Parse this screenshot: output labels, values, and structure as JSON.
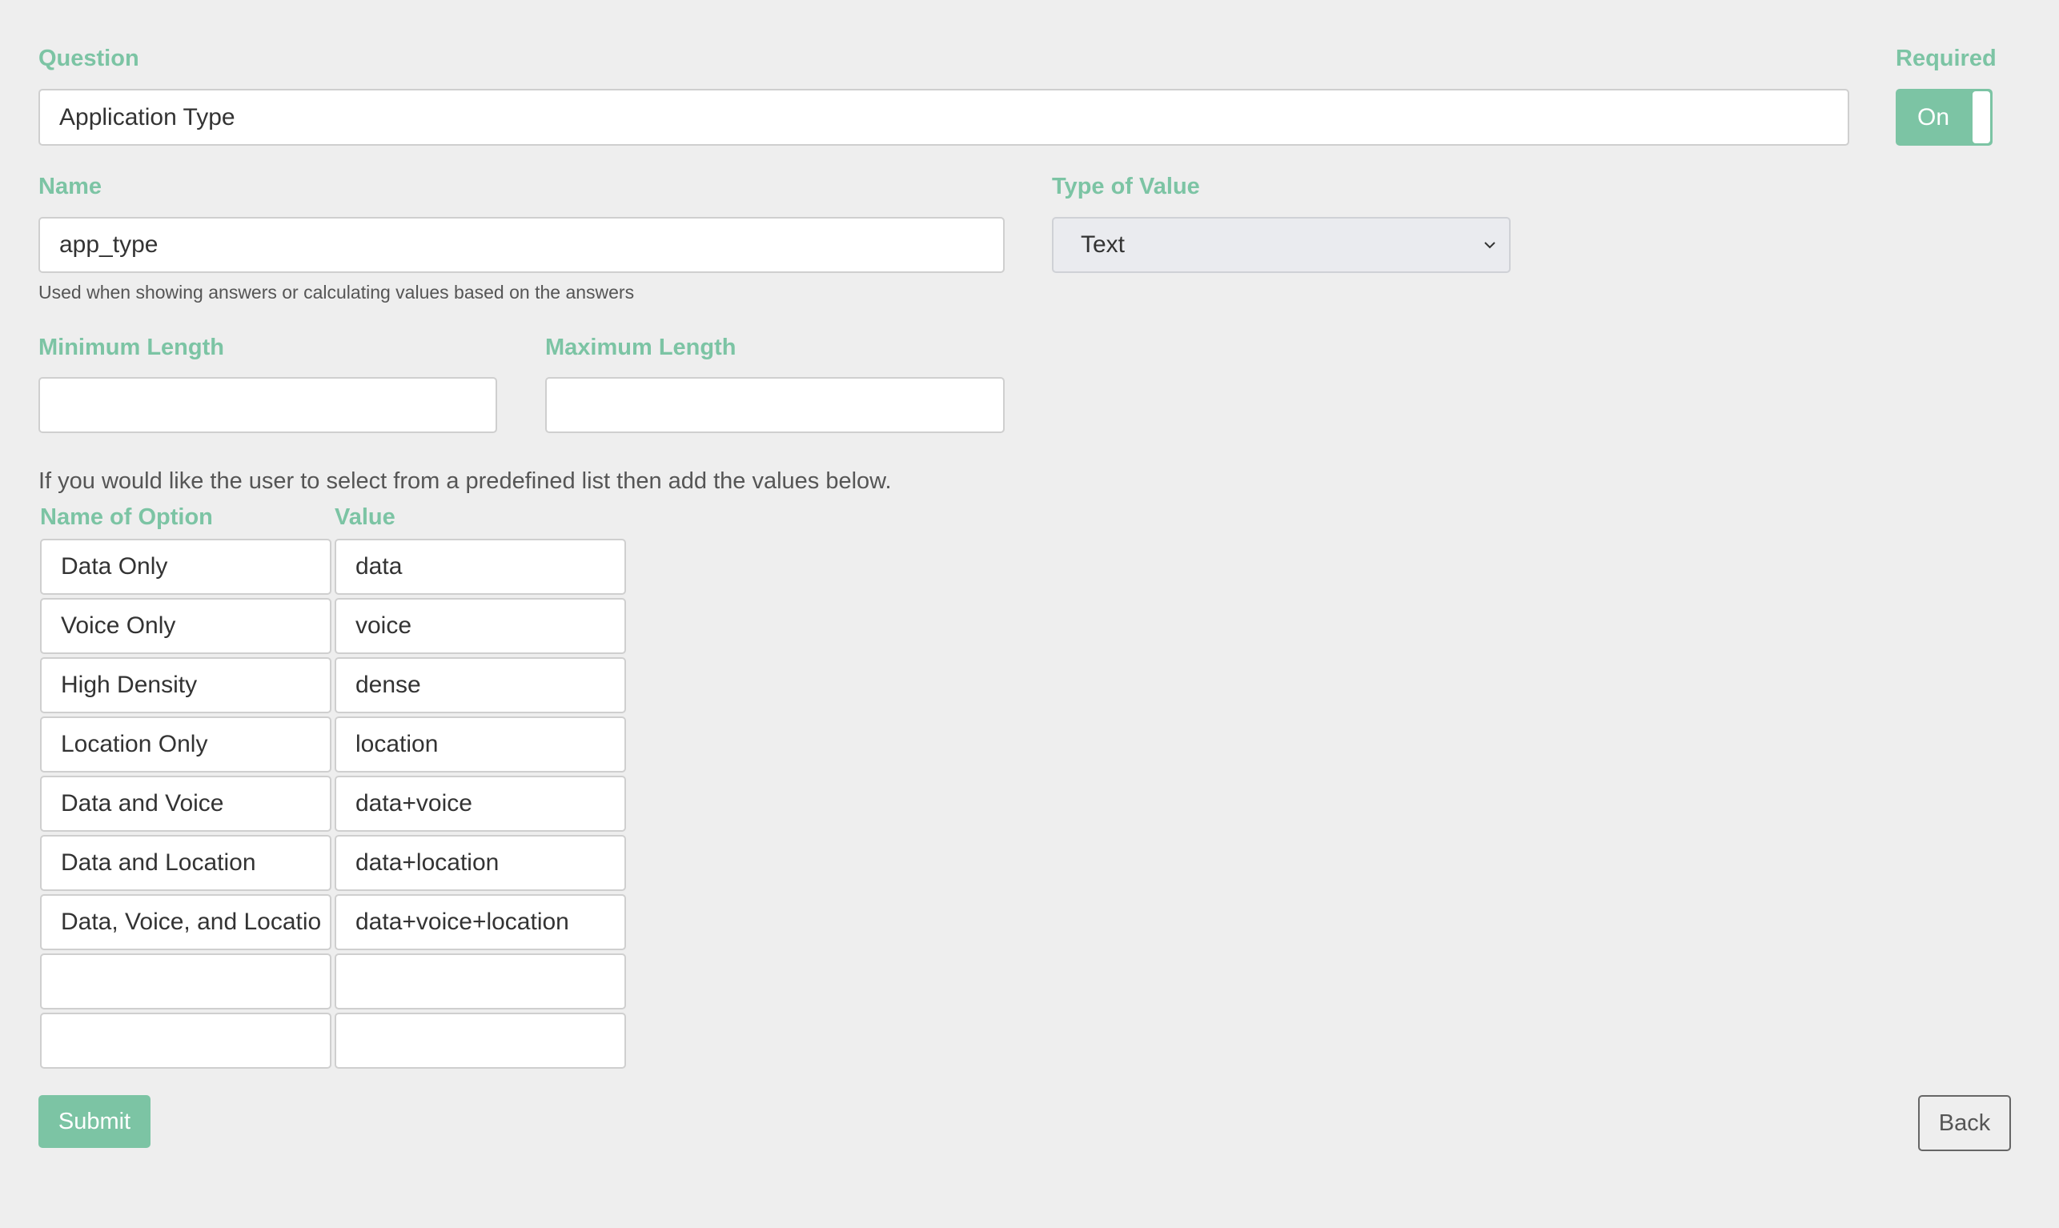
{
  "question": {
    "label": "Question",
    "value": "Application Type"
  },
  "required": {
    "label": "Required",
    "toggle_label": "On",
    "is_on": true
  },
  "name_field": {
    "label": "Name",
    "value": "app_type",
    "help": "Used when showing answers or calculating values based on the answers"
  },
  "type_of_value": {
    "label": "Type of Value",
    "selected": "Text"
  },
  "min_length": {
    "label": "Minimum Length",
    "value": ""
  },
  "max_length": {
    "label": "Maximum Length",
    "value": ""
  },
  "options": {
    "instructions": "If you would like the user to select from a predefined list then add the values below.",
    "name_header": "Name of Option",
    "value_header": "Value",
    "rows": [
      {
        "name": "Data Only",
        "value": "data"
      },
      {
        "name": "Voice Only",
        "value": "voice"
      },
      {
        "name": "High Density",
        "value": "dense"
      },
      {
        "name": "Location Only",
        "value": "location"
      },
      {
        "name": "Data and Voice",
        "value": "data+voice"
      },
      {
        "name": "Data and Location",
        "value": "data+location"
      },
      {
        "name": "Data, Voice, and Locatio",
        "value": "data+voice+location"
      },
      {
        "name": "",
        "value": ""
      },
      {
        "name": "",
        "value": ""
      }
    ]
  },
  "buttons": {
    "submit": "Submit",
    "back": "Back"
  },
  "colors": {
    "accent": "#7cc4a4",
    "background": "#eeeeee"
  },
  "icons": {
    "select_chevron": "chevron-down-icon"
  }
}
